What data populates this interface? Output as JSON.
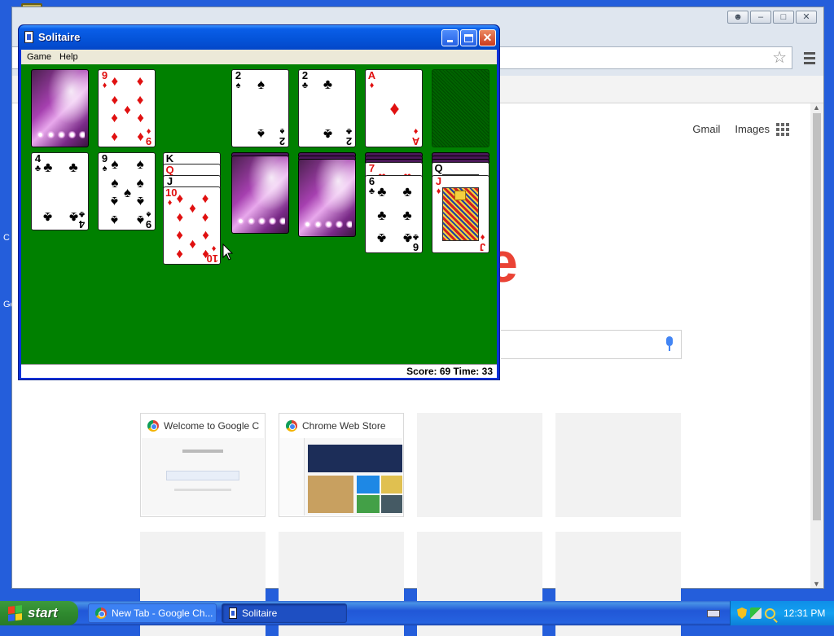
{
  "solitaire": {
    "title": "Solitaire",
    "menu": [
      "Game",
      "Help"
    ],
    "status": "Score: 69 Time: 33",
    "foundations": [
      {
        "rank": "2",
        "suit": "♠",
        "color": "blk"
      },
      {
        "rank": "2",
        "suit": "♣",
        "color": "blk"
      },
      {
        "rank": "A",
        "suit": "♦",
        "color": "red"
      }
    ],
    "waste": {
      "rank": "9",
      "suit": "♦",
      "color": "red"
    },
    "tableau": [
      {
        "hidden": 0,
        "cards": [
          {
            "rank": "4",
            "suit": "♣",
            "color": "blk"
          }
        ]
      },
      {
        "hidden": 0,
        "cards": [
          {
            "rank": "9",
            "suit": "♠",
            "color": "blk"
          }
        ]
      },
      {
        "hidden": 0,
        "cards": [
          {
            "rank": "K",
            "suit": "",
            "color": "blk"
          },
          {
            "rank": "Q",
            "suit": "",
            "color": "red"
          },
          {
            "rank": "J",
            "suit": "",
            "color": "blk"
          },
          {
            "rank": "10",
            "suit": "♦",
            "color": "red"
          }
        ]
      },
      {
        "hidden": 1,
        "cards": []
      },
      {
        "hidden": 2,
        "cards": []
      },
      {
        "hidden": 3,
        "cards": [
          {
            "rank": "7",
            "suit": "♥",
            "color": "red"
          },
          {
            "rank": "6",
            "suit": "♣",
            "color": "blk"
          }
        ]
      },
      {
        "hidden": 3,
        "cards": [
          {
            "rank": "Q",
            "suit": "",
            "color": "blk"
          },
          {
            "rank": "J",
            "suit": "♦",
            "color": "red"
          }
        ]
      }
    ]
  },
  "chrome": {
    "links": [
      "Gmail",
      "Images"
    ],
    "logo_fragment": "e",
    "tiles": [
      {
        "title": "Welcome to Google C"
      },
      {
        "title": "Chrome Web Store"
      }
    ]
  },
  "desktop": {
    "fragments": [
      "C",
      "Go"
    ]
  },
  "taskbar": {
    "start_label": "start",
    "tasks": [
      "New Tab - Google Ch...",
      "Solitaire"
    ],
    "clock": "12:31 PM"
  },
  "icons": {
    "window_controls": [
      "minimize-icon",
      "maximize-icon",
      "close-icon"
    ],
    "tray": [
      "shield-icon",
      "network-icon",
      "search-icon"
    ]
  }
}
